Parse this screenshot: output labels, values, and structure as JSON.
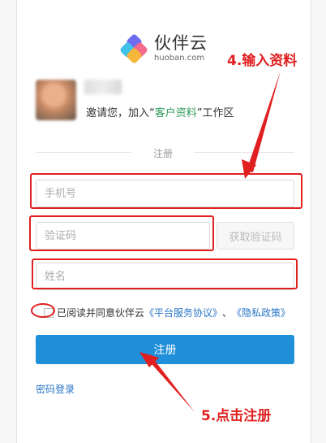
{
  "brand": {
    "name": "伙伴云",
    "domain": "huoban.com"
  },
  "invite": {
    "prefix": "邀请您，加入“",
    "app_name": "客户资料",
    "suffix": "”工作区"
  },
  "form": {
    "section_label": "注册",
    "phone_placeholder": "手机号",
    "code_placeholder": "验证码",
    "get_code_label": "获取验证码",
    "name_placeholder": "姓名",
    "agree_prefix": "已阅读并同意伙伴云",
    "terms_link": "《平台服务协议》",
    "separator": "、",
    "privacy_link": "《隐私政策》",
    "submit_label": "注册",
    "password_login_label": "密码登录"
  },
  "annotations": {
    "step4": "4.输入资料",
    "step5": "5.点击注册"
  },
  "colors": {
    "accent": "#1e8fd8",
    "annotation": "#e02020",
    "link": "#2a76c6",
    "app_name": "#2e9a5a"
  }
}
